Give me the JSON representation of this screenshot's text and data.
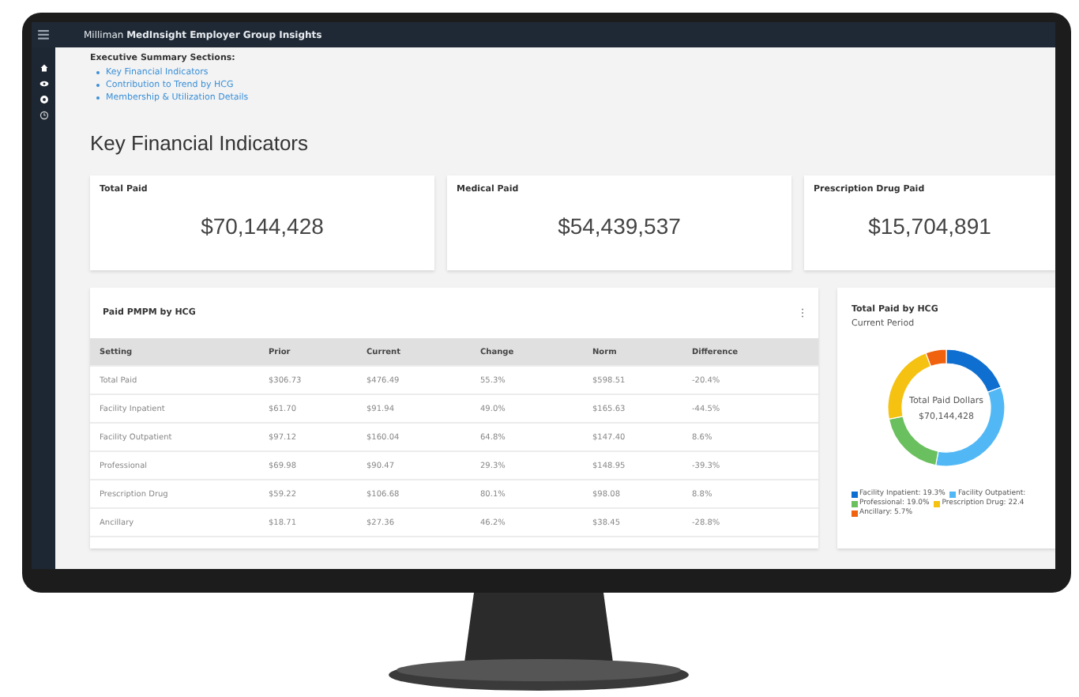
{
  "header": {
    "title": "Milliman **MedInsight Employer Group Insights**"
  },
  "sidebar": {
    "items": [
      {
        "kind": "home"
      },
      {
        "kind": "eye"
      },
      {
        "kind": "gear"
      },
      {
        "kind": "clock"
      }
    ]
  },
  "summary": {
    "heading": "Executive Summary Sections:",
    "links": [
      "Key Financial Indicators",
      "Contribution to Trend by HCG",
      "Membership & Utilization Details"
    ]
  },
  "page_title": "Key Financial Indicators",
  "kpis": [
    {
      "label": "Total Paid",
      "value": "$70,144,428"
    },
    {
      "label": "Medical Paid",
      "value": "$54,439,537"
    },
    {
      "label": "Prescription Drug Paid",
      "value": "$15,704,891"
    }
  ],
  "table_panel": {
    "title": "Paid PMPM by HCG",
    "columns": [
      "Setting",
      "Prior",
      "Current",
      "Change",
      "Norm",
      "Difference"
    ],
    "rows": [
      [
        "Total Paid",
        "$306.73",
        "$476.49",
        "55.3%",
        "$598.51",
        "-20.4%"
      ],
      [
        "Facility Inpatient",
        "$61.70",
        "$91.94",
        "49.0%",
        "$165.63",
        "-44.5%"
      ],
      [
        "Facility Outpatient",
        "$97.12",
        "$160.04",
        "64.8%",
        "$147.40",
        "8.6%"
      ],
      [
        "Professional",
        "$69.98",
        "$90.47",
        "29.3%",
        "$148.95",
        "-39.3%"
      ],
      [
        "Prescription Drug",
        "$59.22",
        "$106.68",
        "80.1%",
        "$98.08",
        "8.8%"
      ],
      [
        "Ancillary",
        "$18.71",
        "$27.36",
        "46.2%",
        "$38.45",
        "-28.8%"
      ]
    ]
  },
  "donut_panel": {
    "title": "Total Paid by HCG",
    "subtitle": "Current Period",
    "center_label": "Total Paid Dollars",
    "center_value": "$70,144,428",
    "chart_data": {
      "type": "donut",
      "values": [
        19.3,
        33.6,
        19.0,
        22.4,
        5.7
      ]
    },
    "legend": [
      {
        "label": "Facility Inpatient: 19.3%",
        "color": "#0f6fd1"
      },
      {
        "label": "Facility Outpatient: ",
        "color": "#52b8f5"
      },
      {
        "label": "Professional: 19.0%",
        "color": "#6abf5e"
      },
      {
        "label": "Prescription Drug: 22.4",
        "color": "#f5c211"
      },
      {
        "label": "Ancillary: 5.7%",
        "color": "#f0620e"
      }
    ]
  }
}
